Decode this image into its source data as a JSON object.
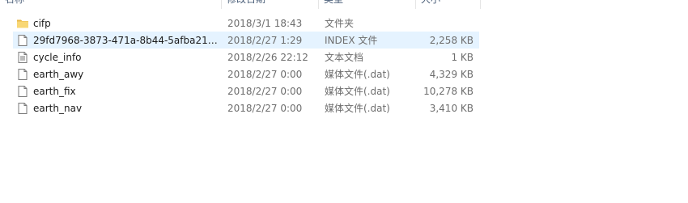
{
  "columns": {
    "name": "名称",
    "date": "修改日期",
    "type": "类型",
    "size": "大小"
  },
  "files": [
    {
      "name": "cifp",
      "date": "2018/3/1 18:43",
      "type": "文件夹",
      "size": "",
      "icon": "folder-icon",
      "selected": false
    },
    {
      "name": "29fd7968-3873-471a-8b44-5afba214...",
      "date": "2018/2/27 1:29",
      "type": "INDEX 文件",
      "size": "2,258 KB",
      "icon": "file-icon",
      "selected": true
    },
    {
      "name": "cycle_info",
      "date": "2018/2/26 22:12",
      "type": "文本文档",
      "size": "1 KB",
      "icon": "text-file-icon",
      "selected": false
    },
    {
      "name": "earth_awy",
      "date": "2018/2/27 0:00",
      "type": "媒体文件(.dat)",
      "size": "4,329 KB",
      "icon": "file-icon",
      "selected": false
    },
    {
      "name": "earth_fix",
      "date": "2018/2/27 0:00",
      "type": "媒体文件(.dat)",
      "size": "10,278 KB",
      "icon": "file-icon",
      "selected": false
    },
    {
      "name": "earth_nav",
      "date": "2018/2/27 0:00",
      "type": "媒体文件(.dat)",
      "size": "3,410 KB",
      "icon": "file-icon",
      "selected": false
    }
  ]
}
